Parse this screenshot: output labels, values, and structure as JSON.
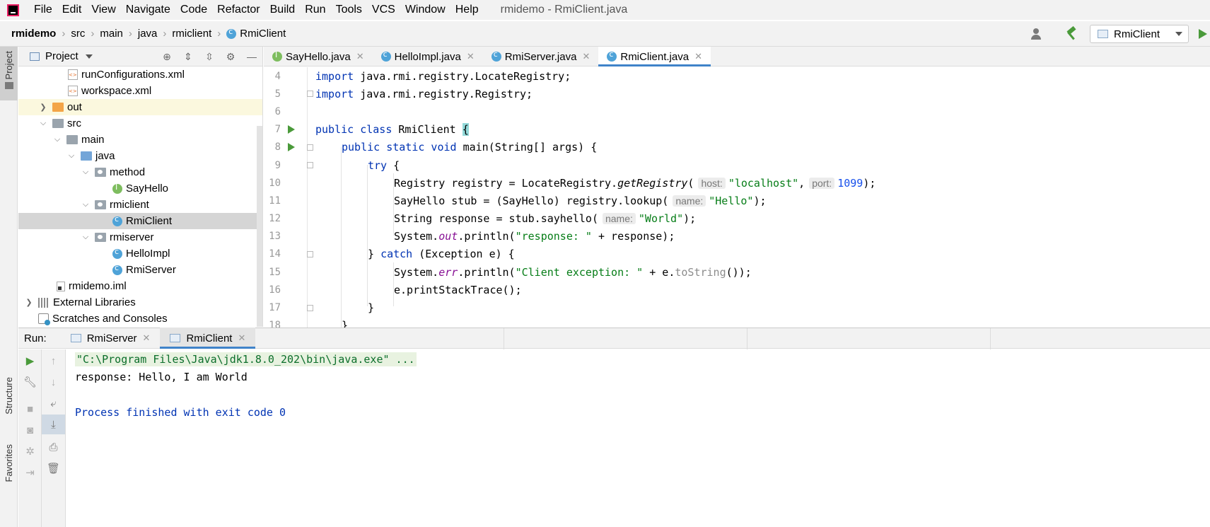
{
  "menu": {
    "items": [
      "File",
      "Edit",
      "View",
      "Navigate",
      "Code",
      "Refactor",
      "Build",
      "Run",
      "Tools",
      "VCS",
      "Window",
      "Help"
    ],
    "window_title": "rmidemo - RmiClient.java"
  },
  "breadcrumb": {
    "items": [
      "rmidemo",
      "src",
      "main",
      "java",
      "rmiclient",
      "RmiClient"
    ]
  },
  "toolbar": {
    "run_config": "RmiClient"
  },
  "left_stripe": {
    "project_label": "Project",
    "structure_label": "Structure",
    "favorites_label": "Favorites"
  },
  "project_panel": {
    "title": "Project",
    "tree": [
      {
        "label": "runConfigurations.xml",
        "icon": "xml-file-icon"
      },
      {
        "label": "workspace.xml",
        "icon": "xml-file-icon"
      },
      {
        "label": "out",
        "icon": "folder-orange-icon"
      },
      {
        "label": "src",
        "icon": "folder-icon"
      },
      {
        "label": "main",
        "icon": "folder-icon"
      },
      {
        "label": "java",
        "icon": "source-folder-icon"
      },
      {
        "label": "method",
        "icon": "package-icon"
      },
      {
        "label": "SayHello",
        "icon": "interface-icon"
      },
      {
        "label": "rmiclient",
        "icon": "package-icon"
      },
      {
        "label": "RmiClient",
        "icon": "class-icon"
      },
      {
        "label": "rmiserver",
        "icon": "package-icon"
      },
      {
        "label": "HelloImpl",
        "icon": "class-icon"
      },
      {
        "label": "RmiServer",
        "icon": "class-icon"
      },
      {
        "label": "rmidemo.iml",
        "icon": "module-file-icon"
      },
      {
        "label": "External Libraries",
        "icon": "library-icon"
      },
      {
        "label": "Scratches and Consoles",
        "icon": "scratches-icon"
      }
    ]
  },
  "editor": {
    "tabs": [
      "SayHello.java",
      "HelloImpl.java",
      "RmiServer.java",
      "RmiClient.java"
    ],
    "line_numbers": [
      "4",
      "5",
      "6",
      "7",
      "8",
      "9",
      "10",
      "11",
      "12",
      "13",
      "14",
      "15",
      "16",
      "17",
      "18"
    ],
    "code": {
      "l4_kw": "import",
      "l4_rest": " java.rmi.registry.LocateRegistry;",
      "l5_kw": "import",
      "l5_rest": " java.rmi.registry.Registry;",
      "l7_kw": "public class",
      "l7_name": " RmiClient ",
      "l7_brace": "{",
      "l8_kw": "public static void",
      "l8_rest": " main(String[] args) {",
      "l9_kw": "try",
      "l9_rest": " {",
      "l10_a": "Registry registry = LocateRegistry.",
      "l10_method": "getRegistry",
      "l10_b": "(",
      "l10_hint1": "host:",
      "l10_str": "\"localhost\"",
      "l10_c": ",",
      "l10_hint2": "port:",
      "l10_num": "1099",
      "l10_d": ");",
      "l11_a": "SayHello stub = (SayHello) registry.lookup(",
      "l11_hint": "name:",
      "l11_str": "\"Hello\"",
      "l11_b": ");",
      "l12_a": "String response = stub.sayhello(",
      "l12_hint": "name:",
      "l12_str": "\"World\"",
      "l12_b": ");",
      "l13_a": "System.",
      "l13_field": "out",
      "l13_b": ".println(",
      "l13_str": "\"response: \"",
      "l13_c": " + response);",
      "l14_a": "} ",
      "l14_kw": "catch",
      "l14_b": " (Exception e) {",
      "l15_a": "System.",
      "l15_field": "err",
      "l15_b": ".println(",
      "l15_str": "\"Client exception: \"",
      "l15_c": " + e.",
      "l15_m": "toString",
      "l15_d": "());",
      "l16": "e.printStackTrace();",
      "l17": "}",
      "l18": "}"
    }
  },
  "run_panel": {
    "label": "Run:",
    "tabs": [
      "RmiServer",
      "RmiClient"
    ],
    "console": {
      "cmd": "\"C:\\Program Files\\Java\\jdk1.8.0_202\\bin\\java.exe\" ...",
      "output": "response: Hello, I am World",
      "exit": "Process finished with exit code 0"
    }
  },
  "colors": {
    "keyword": "#0033b3",
    "string": "#067d17",
    "number": "#1750eb",
    "static_field": "#871094",
    "accent": "#4083c9",
    "run_green": "#4a9a3a"
  }
}
